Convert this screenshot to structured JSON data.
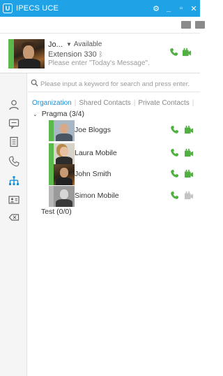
{
  "window": {
    "logo_glyph": "U",
    "title": "IPECS UCE",
    "controls": {
      "settings": "⚙",
      "minimize": "_",
      "maximize": "▫",
      "close": "✕"
    },
    "accent_color": "#1fa3e6"
  },
  "profile": {
    "name": "Jo...",
    "status": "Available",
    "extension": "Extension 330",
    "message_placeholder": "Please enter \"Today's Message\".",
    "presence_color": "#5ab94a"
  },
  "search": {
    "placeholder": "Please input a keyword for search and press enter."
  },
  "sidebar": {
    "items": [
      {
        "name": "profile",
        "icon": "person-icon"
      },
      {
        "name": "chat",
        "icon": "chat-bubble-icon"
      },
      {
        "name": "notes",
        "icon": "document-icon"
      },
      {
        "name": "calls",
        "icon": "phone-icon"
      },
      {
        "name": "organization",
        "icon": "org-chart-icon",
        "active": true
      },
      {
        "name": "contacts",
        "icon": "contact-card-icon"
      },
      {
        "name": "tags",
        "icon": "tag-icon"
      }
    ]
  },
  "tabs": [
    {
      "label": "Organization",
      "active": true
    },
    {
      "label": "Shared Contacts",
      "active": false
    },
    {
      "label": "Private Contacts",
      "active": false
    }
  ],
  "groups": [
    {
      "label": "Pragma (3/4)",
      "expanded": true,
      "toggle_glyph": "⌄",
      "contacts": [
        {
          "name": "Joe Bloggs",
          "presence": "available",
          "strip_color": "#5ab94a",
          "video_enabled": true
        },
        {
          "name": "Laura Mobile",
          "presence": "available",
          "strip_color": "#5ab94a",
          "video_enabled": true
        },
        {
          "name": "John Smith",
          "presence": "available",
          "strip_color": "#5ab94a",
          "video_enabled": true
        },
        {
          "name": "Simon Mobile",
          "presence": "offline",
          "strip_color": "#b8b8b8",
          "video_enabled": false
        }
      ]
    },
    {
      "label": "Test (0/0)",
      "expanded": false,
      "contacts": []
    }
  ],
  "colors": {
    "call_green": "#52b043",
    "video_green": "#52b043",
    "video_disabled": "#c4c4c4",
    "tab_active": "#1a8fd6"
  }
}
